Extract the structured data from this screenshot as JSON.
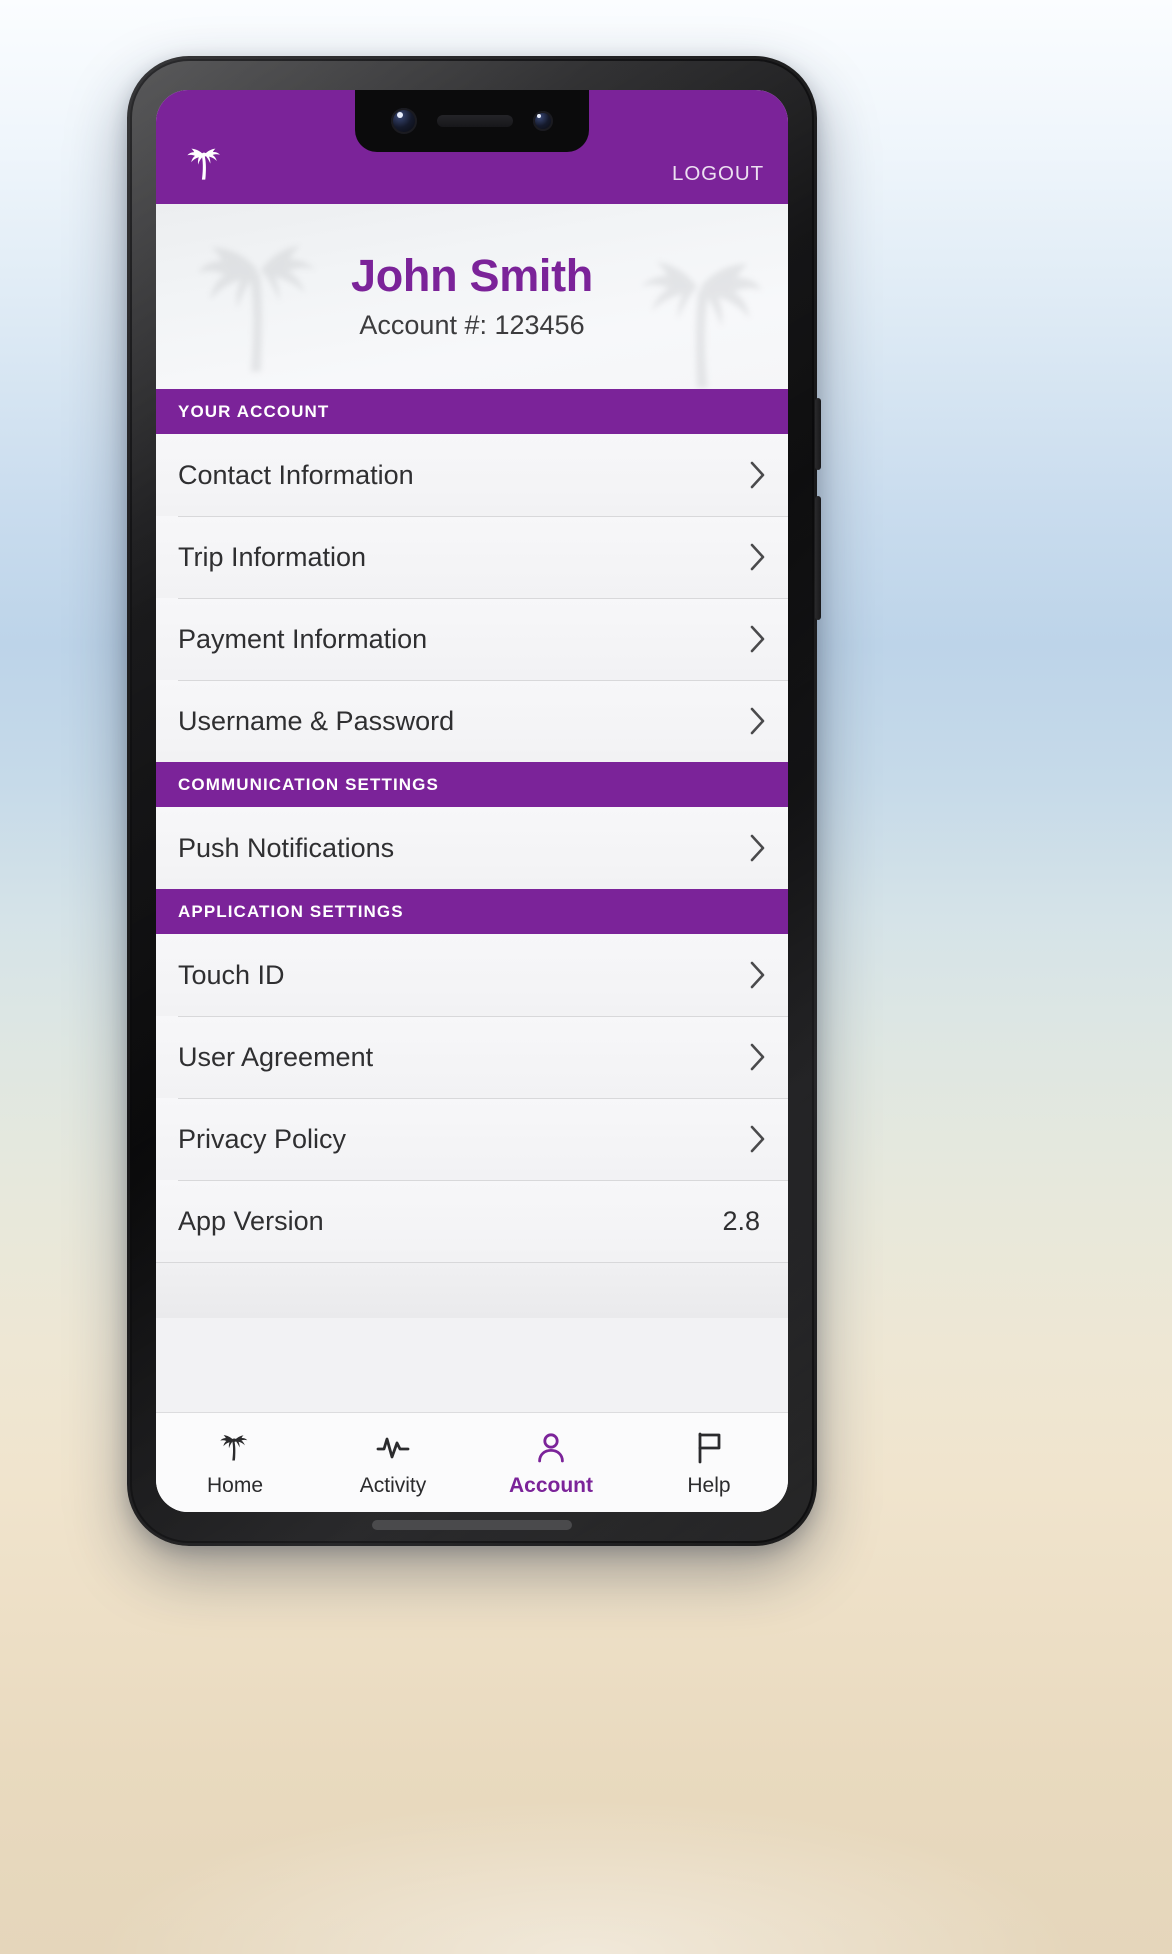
{
  "appbar": {
    "logo_icon": "palm-tree-icon",
    "logout_label": "LOGOUT"
  },
  "profile": {
    "name": "John Smith",
    "account_line": "Account #: 123456"
  },
  "sections": [
    {
      "header": "YOUR ACCOUNT",
      "rows": [
        {
          "label": "Contact Information",
          "accessory": "chevron-right-icon",
          "value": ""
        },
        {
          "label": "Trip Information",
          "accessory": "chevron-right-icon",
          "value": ""
        },
        {
          "label": "Payment Information",
          "accessory": "chevron-right-icon",
          "value": ""
        },
        {
          "label": "Username & Password",
          "accessory": "chevron-right-icon",
          "value": ""
        }
      ]
    },
    {
      "header": "COMMUNICATION SETTINGS",
      "rows": [
        {
          "label": "Push Notifications",
          "accessory": "chevron-right-icon",
          "value": ""
        }
      ]
    },
    {
      "header": "APPLICATION SETTINGS",
      "rows": [
        {
          "label": "Touch ID",
          "accessory": "chevron-right-icon",
          "value": ""
        },
        {
          "label": "User Agreement",
          "accessory": "chevron-right-icon",
          "value": ""
        },
        {
          "label": "Privacy Policy",
          "accessory": "chevron-right-icon",
          "value": ""
        },
        {
          "label": "App Version",
          "accessory": "value",
          "value": "2.8"
        }
      ]
    }
  ],
  "tabbar": {
    "items": [
      {
        "label": "Home",
        "icon": "palm-tree-icon",
        "active": false
      },
      {
        "label": "Activity",
        "icon": "activity-pulse-icon",
        "active": false
      },
      {
        "label": "Account",
        "icon": "person-icon",
        "active": true
      },
      {
        "label": "Help",
        "icon": "flag-icon",
        "active": false
      }
    ]
  },
  "colors": {
    "brand_purple": "#7b2399",
    "list_background": "#f5f5f7",
    "text_primary": "#2f2f31",
    "divider": "#d8d8da"
  }
}
